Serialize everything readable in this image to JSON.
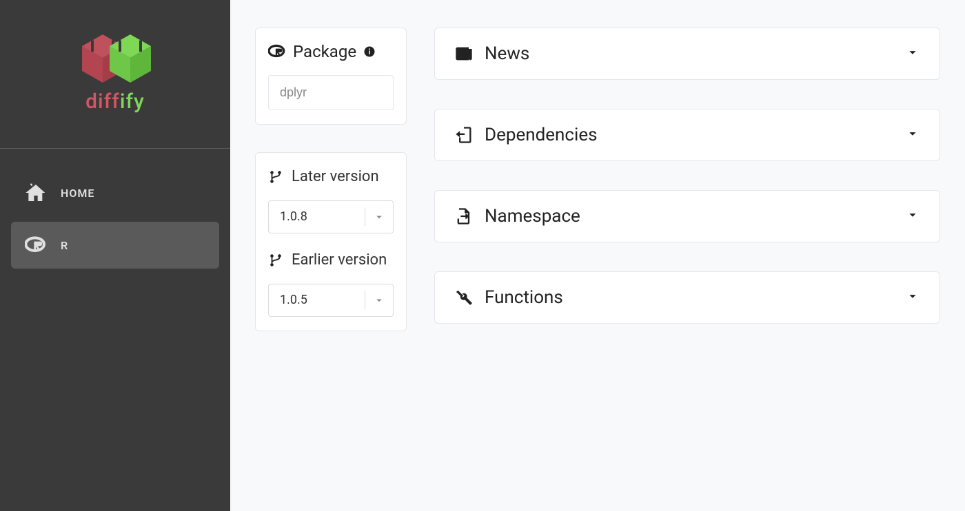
{
  "brand": {
    "name_part1": "diff",
    "name_part2": "ify"
  },
  "nav": {
    "home": "HOME",
    "r": "R"
  },
  "controls": {
    "package_label": "Package",
    "package_value": "dplyr",
    "later_version_label": "Later version",
    "later_version_value": "1.0.8",
    "earlier_version_label": "Earlier version",
    "earlier_version_value": "1.0.5"
  },
  "panels": {
    "news": "News",
    "dependencies": "Dependencies",
    "namespace": "Namespace",
    "functions": "Functions"
  }
}
